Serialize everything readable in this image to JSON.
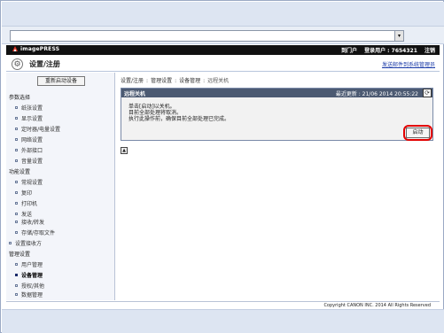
{
  "header": {
    "brand": "imagePRESS",
    "portal_link": "到门户",
    "user_label": "登录用户 : 7654321",
    "logout_link": "注销"
  },
  "title_bar": {
    "title": "设置/注册",
    "link": "发送邮件到系统管理员"
  },
  "sidebar": {
    "reboot_button": "重新启动设备",
    "sections": [
      {
        "label": "参数选择",
        "items": [
          "纸张设置",
          "显示设置",
          "定时器/电量设置",
          "网络设置",
          "外部接口",
          "音量设置"
        ]
      },
      {
        "label": "功能设置",
        "items": [
          "常规设置",
          "复印",
          "打印机",
          "发送",
          "接收/转发",
          "存储/存取文件"
        ]
      }
    ],
    "receive_settings": "设置接收方",
    "management": {
      "label": "管理设置",
      "items": [
        "用户管理",
        "设备管理",
        "授权/其他",
        "数据管理"
      ]
    }
  },
  "breadcrumb": [
    "设置/注册",
    "管理设置",
    "设备管理",
    "远程关机"
  ],
  "panel": {
    "title": "远程关机",
    "updated": "最近更新 : 21/06 2014 20:55:22",
    "messages": [
      "单击[启动]以关机。",
      "目前全部处理将取消。",
      "执行此操作前，确保目前全部处理已完成。"
    ],
    "start_button": "启动"
  },
  "footer": {
    "copyright": "Copyright CANON INC. 2014 All Rights Reserved"
  },
  "colors": {
    "brand_bar": "#111111",
    "panel_head": "#4c5a72",
    "highlight": "#e30000",
    "link": "#1a3aa8"
  }
}
